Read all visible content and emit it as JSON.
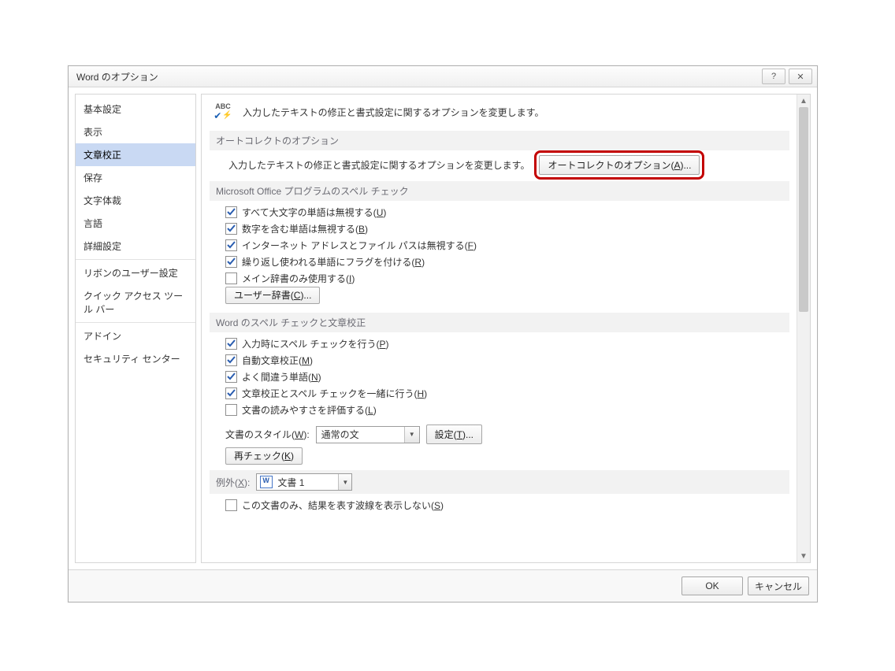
{
  "dialog": {
    "title": "Word のオプション",
    "help_symbol": "?",
    "close_symbol": "✕"
  },
  "sidebar": {
    "items": [
      {
        "label": "基本設定",
        "selected": false
      },
      {
        "label": "表示",
        "selected": false
      },
      {
        "label": "文章校正",
        "selected": true
      },
      {
        "label": "保存",
        "selected": false
      },
      {
        "label": "文字体裁",
        "selected": false
      },
      {
        "label": "言語",
        "selected": false
      },
      {
        "label": "詳細設定",
        "selected": false
      }
    ],
    "items2": [
      {
        "label": "リボンのユーザー設定"
      },
      {
        "label": "クイック アクセス ツール バー"
      }
    ],
    "items3": [
      {
        "label": "アドイン"
      },
      {
        "label": "セキュリティ センター"
      }
    ]
  },
  "header": {
    "icon_abc": "ABC",
    "line": "入力したテキストの修正と書式設定に関するオプションを変更します。"
  },
  "sections": {
    "autocorrect": {
      "title": "オートコレクトのオプション",
      "desc": "入力したテキストの修正と書式設定に関するオプションを変更します。",
      "button_before": "オートコレクトのオプション(",
      "button_ul": "A",
      "button_after": ")..."
    },
    "spellprog": {
      "title": "Microsoft Office プログラムのスペル チェック",
      "opts": [
        {
          "before": "すべて大文字の単語は無視する(",
          "ul": "U",
          "after": ")",
          "checked": true
        },
        {
          "before": "数字を含む単語は無視する(",
          "ul": "B",
          "after": ")",
          "checked": true
        },
        {
          "before": "インターネット アドレスとファイル パスは無視する(",
          "ul": "F",
          "after": ")",
          "checked": true
        },
        {
          "before": "繰り返し使われる単語にフラグを付ける(",
          "ul": "R",
          "after": ")",
          "checked": true
        },
        {
          "before": "メイン辞書のみ使用する(",
          "ul": "I",
          "after": ")",
          "checked": false
        }
      ],
      "userdict_before": "ユーザー辞書(",
      "userdict_ul": "C",
      "userdict_after": ")..."
    },
    "wordspell": {
      "title": "Word のスペル チェックと文章校正",
      "opts": [
        {
          "before": "入力時にスペル チェックを行う(",
          "ul": "P",
          "after": ")",
          "checked": true
        },
        {
          "before": "自動文章校正(",
          "ul": "M",
          "after": ")",
          "checked": true
        },
        {
          "before": "よく間違う単語(",
          "ul": "N",
          "after": ")",
          "checked": true
        },
        {
          "before": "文章校正とスペル チェックを一緒に行う(",
          "ul": "H",
          "after": ")",
          "checked": true
        },
        {
          "before": "文書の読みやすさを評価する(",
          "ul": "L",
          "after": ")",
          "checked": false
        }
      ],
      "style_before": "文書のスタイル(",
      "style_ul": "W",
      "style_after": "):",
      "style_value": "通常の文",
      "settings_before": "設定(",
      "settings_ul": "T",
      "settings_after": ")...",
      "recheck_before": "再チェック(",
      "recheck_ul": "K",
      "recheck_after": ")"
    },
    "exceptions": {
      "title_before": "例外(",
      "title_ul": "X",
      "title_after": "):",
      "doc_value": "文書 1",
      "opt_before": "この文書のみ、結果を表す波線を表示しない(",
      "opt_ul": "S",
      "opt_after": ")",
      "opt_checked": false
    }
  },
  "footer": {
    "ok": "OK",
    "cancel": "キャンセル"
  }
}
